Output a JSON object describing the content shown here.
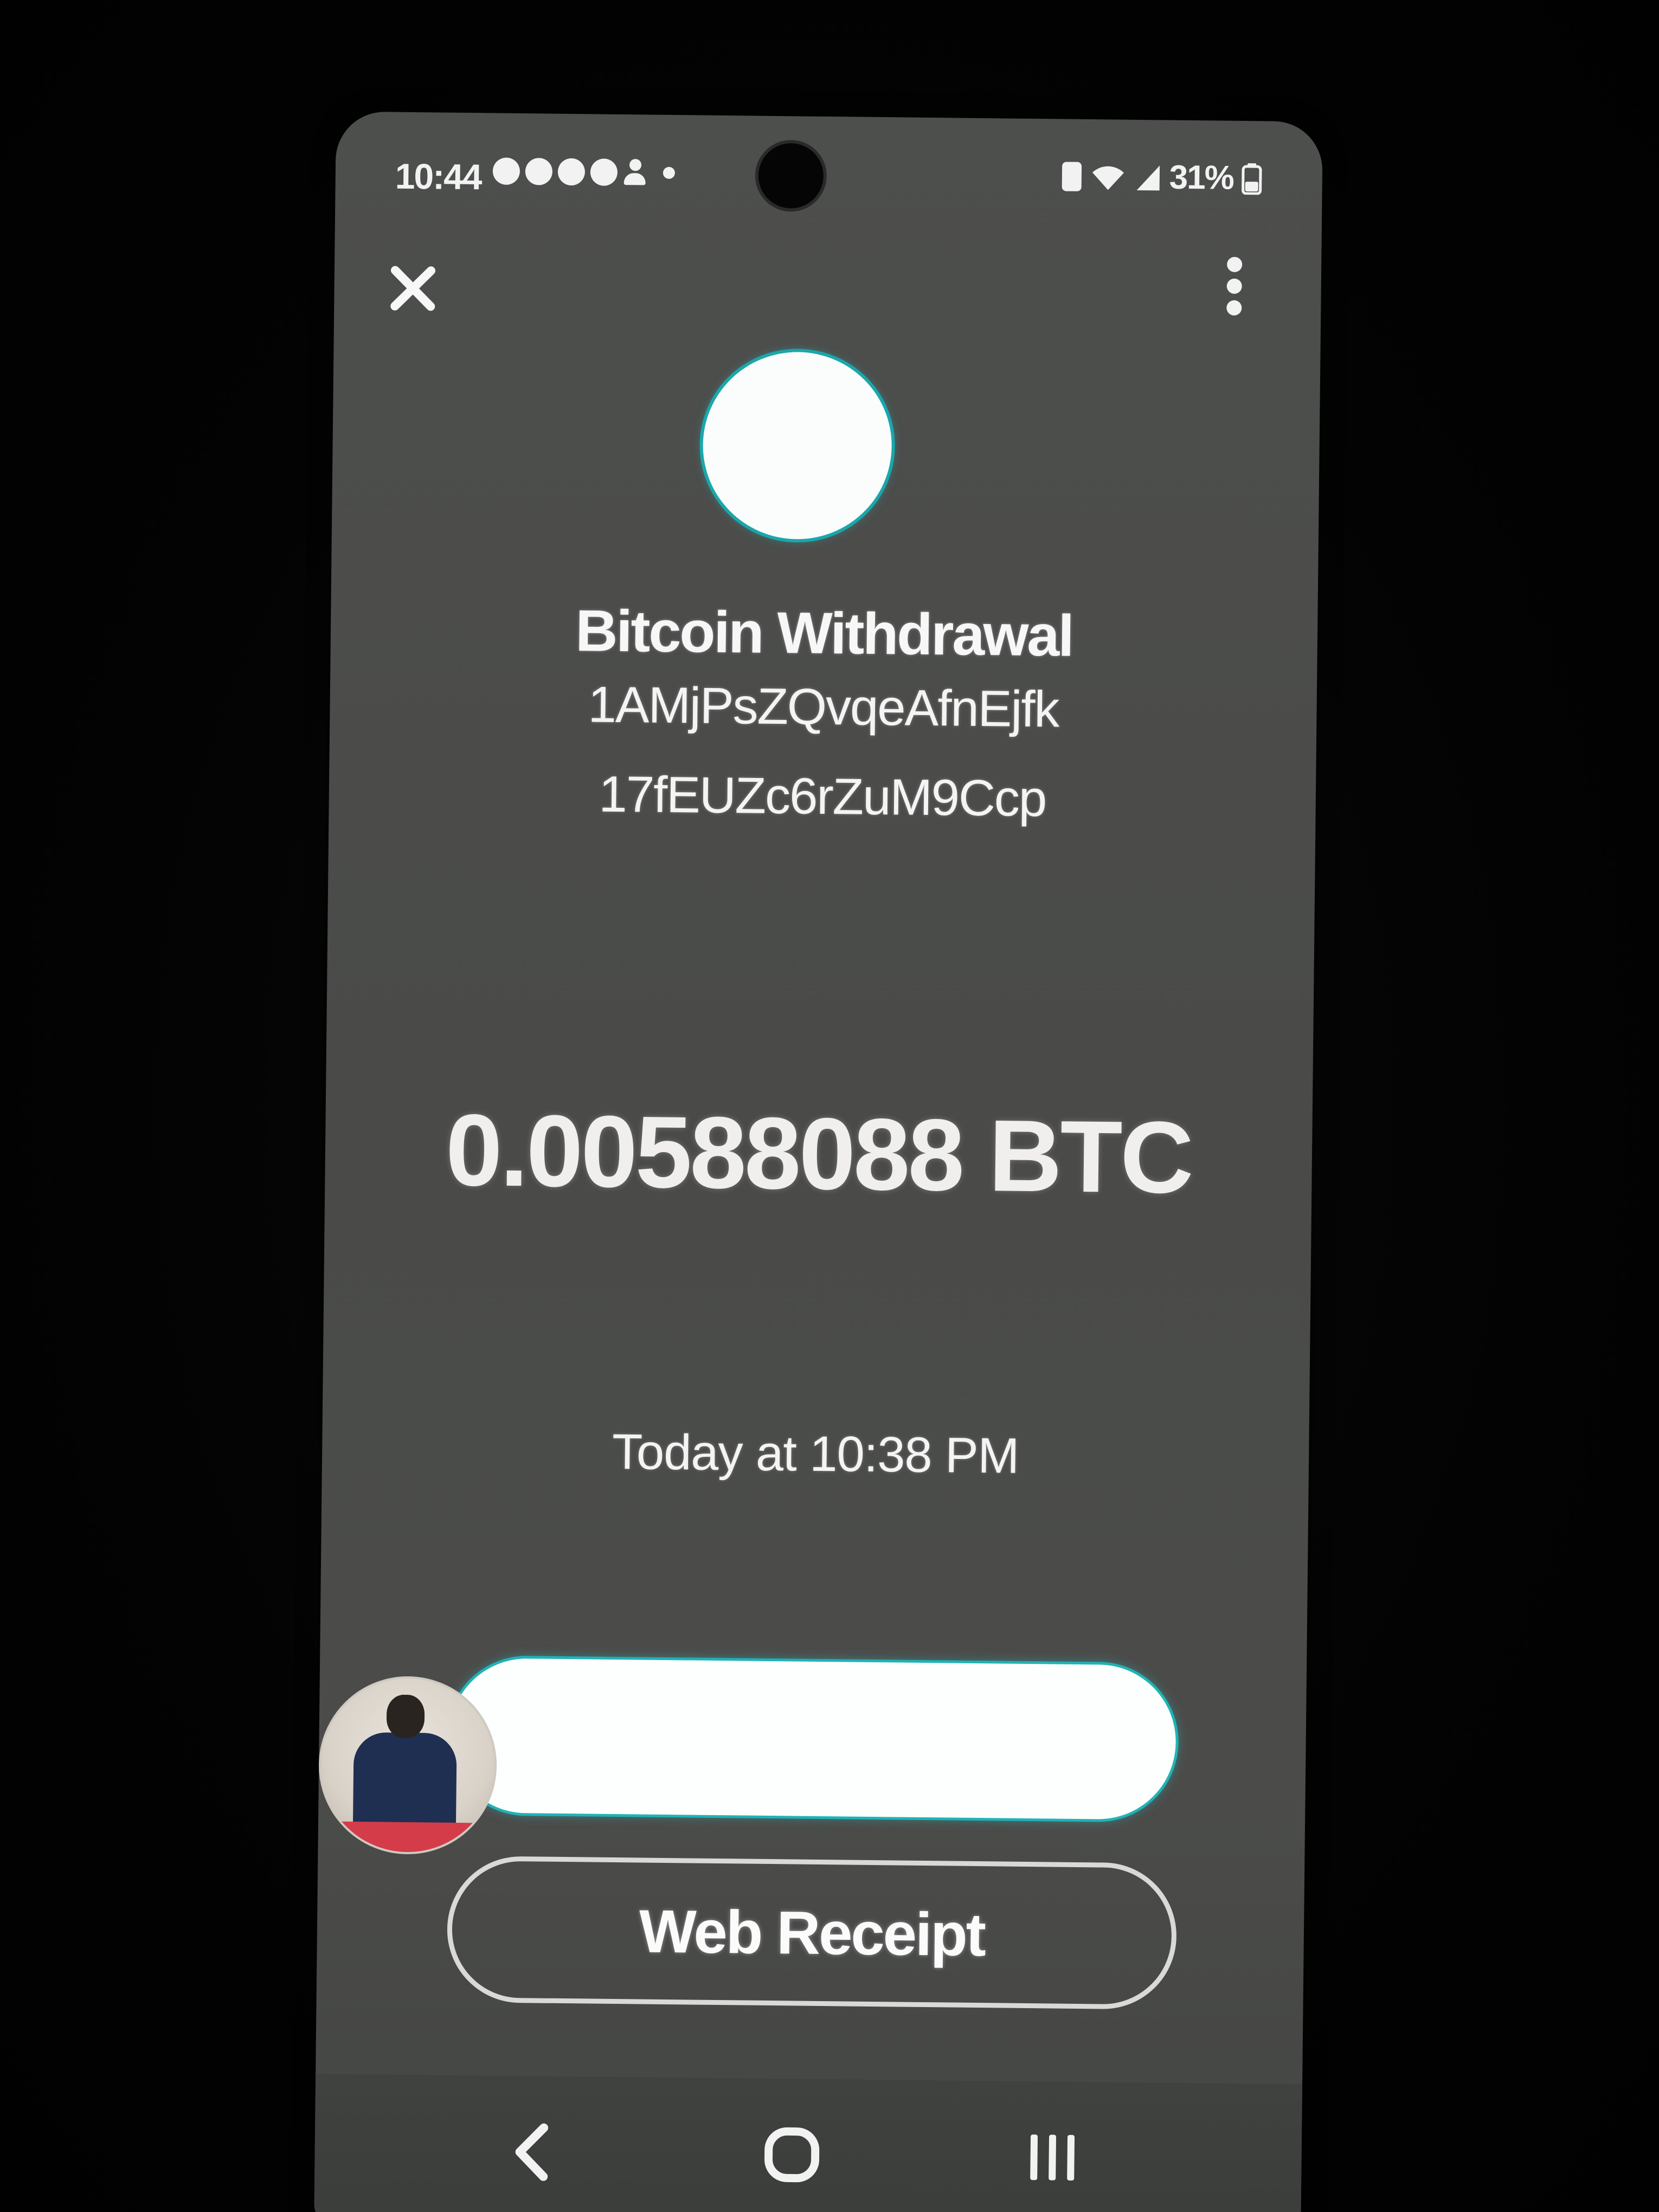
{
  "status_bar": {
    "time": "10:44",
    "battery": "31%"
  },
  "icons": {
    "close": "close-icon",
    "more": "more-vertical-icon",
    "back": "back-chevron-icon",
    "home": "home-icon",
    "recents": "recents-icon"
  },
  "transaction": {
    "title": "Bitcoin Withdrawal",
    "address_line1": "1AMjPsZQvqeAfnEjfk",
    "address_line2": "17fEUZc6rZuM9Ccp",
    "amount": "0.00588088 BTC",
    "timestamp": "Today at 10:38 PM"
  },
  "actions": {
    "web_receipt_label": "Web Receipt"
  },
  "colors": {
    "background": "#4b4c4a",
    "accent": "#1fb3b6",
    "text": "#f4f4f4"
  }
}
